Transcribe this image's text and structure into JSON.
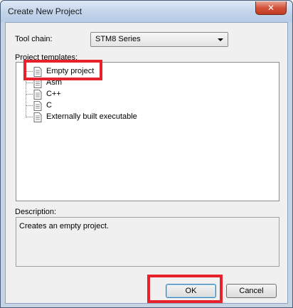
{
  "window": {
    "title": "Create New Project",
    "close_glyph": "✕"
  },
  "toolchain": {
    "label": "Tool chain:",
    "value": "STM8 Series"
  },
  "templates": {
    "label": "Project templates:",
    "items": [
      {
        "label": "Empty project",
        "icon": "document-icon"
      },
      {
        "label": "Asm",
        "icon": "document-icon"
      },
      {
        "label": "C++",
        "icon": "document-icon"
      },
      {
        "label": "C",
        "icon": "document-icon"
      },
      {
        "label": "Externally built executable",
        "icon": "document-icon"
      }
    ]
  },
  "description": {
    "label": "Description:",
    "text": "Creates an empty project."
  },
  "buttons": {
    "ok": "OK",
    "cancel": "Cancel"
  },
  "colors": {
    "highlight": "#e8222a"
  }
}
